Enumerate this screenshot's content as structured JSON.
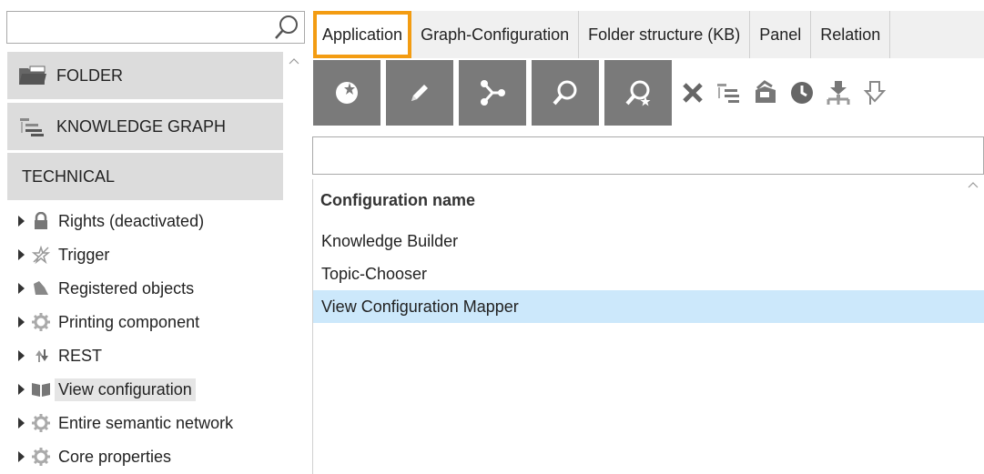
{
  "search": {
    "value": "",
    "icon": "magnifier-icon"
  },
  "sidebar": {
    "sections": [
      {
        "label": "FOLDER",
        "icon": "folder-icon"
      },
      {
        "label": "KNOWLEDGE GRAPH",
        "icon": "hierarchy-list-icon"
      },
      {
        "label": "TECHNICAL"
      }
    ],
    "tree": [
      {
        "label": "Rights (deactivated)",
        "icon": "lock-icon"
      },
      {
        "label": "Trigger",
        "icon": "trigger-icon"
      },
      {
        "label": "Registered objects",
        "icon": "registered-objects-icon"
      },
      {
        "label": "Printing component",
        "icon": "gear-icon"
      },
      {
        "label": "REST",
        "icon": "rest-arrows-icon"
      },
      {
        "label": "View configuration",
        "icon": "book-icon",
        "selected": true
      },
      {
        "label": "Entire semantic network",
        "icon": "gear-icon"
      },
      {
        "label": "Core properties",
        "icon": "gear-icon"
      }
    ]
  },
  "tabs": [
    {
      "label": "Application",
      "active": true
    },
    {
      "label": "Graph-Configuration"
    },
    {
      "label": "Folder structure (KB)"
    },
    {
      "label": "Panel"
    },
    {
      "label": "Relation"
    }
  ],
  "toolbar": {
    "buttons": [
      "new-icon",
      "edit-icon",
      "graph-icon",
      "search-icon",
      "search-new-icon"
    ],
    "icons": [
      "delete-icon",
      "list-icon",
      "export-icon",
      "clock-icon",
      "download-tree-icon",
      "import-icon"
    ]
  },
  "filter": {
    "value": ""
  },
  "table": {
    "header": "Configuration name",
    "rows": [
      {
        "label": "Knowledge Builder"
      },
      {
        "label": "Topic-Chooser"
      },
      {
        "label": "View Configuration Mapper",
        "selected": true
      }
    ]
  },
  "colors": {
    "accent": "#f39c12",
    "selection": "#cce8fb",
    "toolbar_button": "#7a7a7a"
  }
}
